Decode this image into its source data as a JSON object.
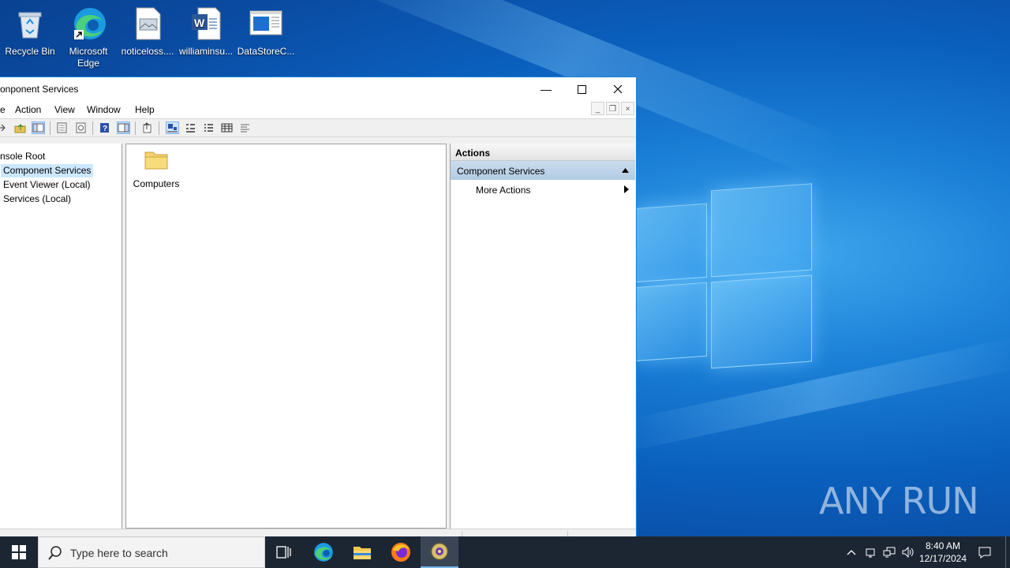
{
  "desktop": {
    "icons": [
      {
        "label": "Recycle Bin"
      },
      {
        "label": "Microsoft Edge"
      },
      {
        "label": "noticeloss...."
      },
      {
        "label": "williaminsu..."
      },
      {
        "label": "DataStoreC..."
      }
    ],
    "watermark": "ANY RUN"
  },
  "window": {
    "title": "onponent Services",
    "menu": [
      "e",
      "Action",
      "View",
      "Window",
      "Help"
    ],
    "tree": {
      "items": [
        "nsole Root",
        "Component Services",
        "Event Viewer (Local)",
        "Services (Local)"
      ],
      "selected": "Component Services"
    },
    "center": {
      "items": [
        {
          "label": "Computers",
          "icon": "folder-icon"
        }
      ]
    },
    "actions": {
      "header": "Actions",
      "section": "Component Services",
      "items": [
        "More Actions"
      ]
    }
  },
  "taskbar": {
    "search_placeholder": "Type here to search",
    "time": "8:40 AM",
    "date": "12/17/2024"
  },
  "colors": {
    "accent": "#0078d7",
    "selection": "#cce8ff",
    "taskbar": "#1c2633"
  }
}
